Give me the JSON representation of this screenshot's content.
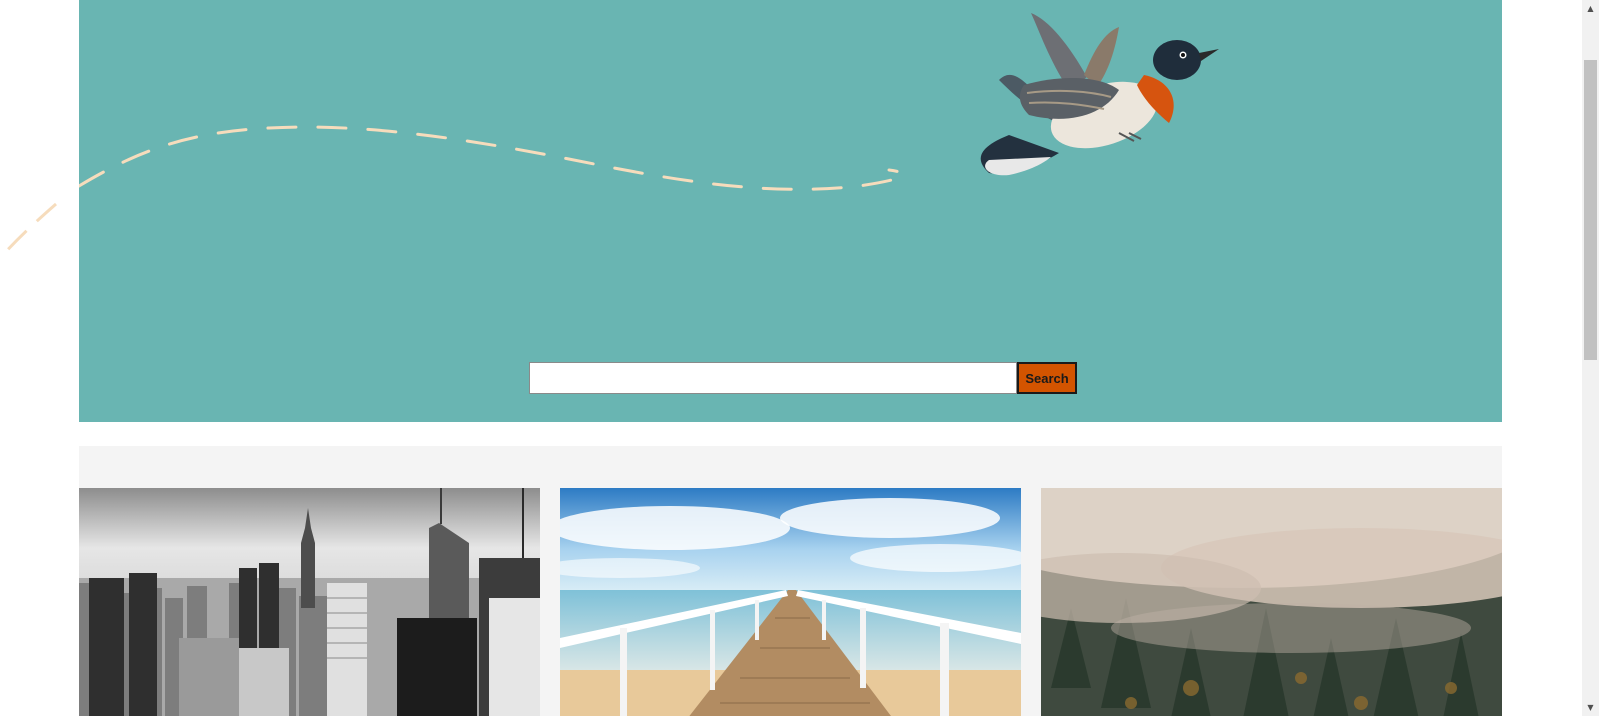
{
  "hero": {
    "background_color": "#69b5b2",
    "path_color": "#f6dcbc",
    "bird_icon": "bird-illustration"
  },
  "search": {
    "placeholder": "",
    "value": "",
    "button_label": "Search",
    "button_color": "#d35400"
  },
  "gallery": {
    "background_color": "#f4f4f4",
    "cards": [
      {
        "name": "city-skyline",
        "icon": "city-skyline-photo"
      },
      {
        "name": "pier-sea",
        "icon": "pier-photo"
      },
      {
        "name": "foggy-forest",
        "icon": "foggy-forest-photo"
      }
    ]
  },
  "scrollbar": {
    "up_icon": "scroll-up-arrow",
    "down_icon": "scroll-down-arrow"
  }
}
